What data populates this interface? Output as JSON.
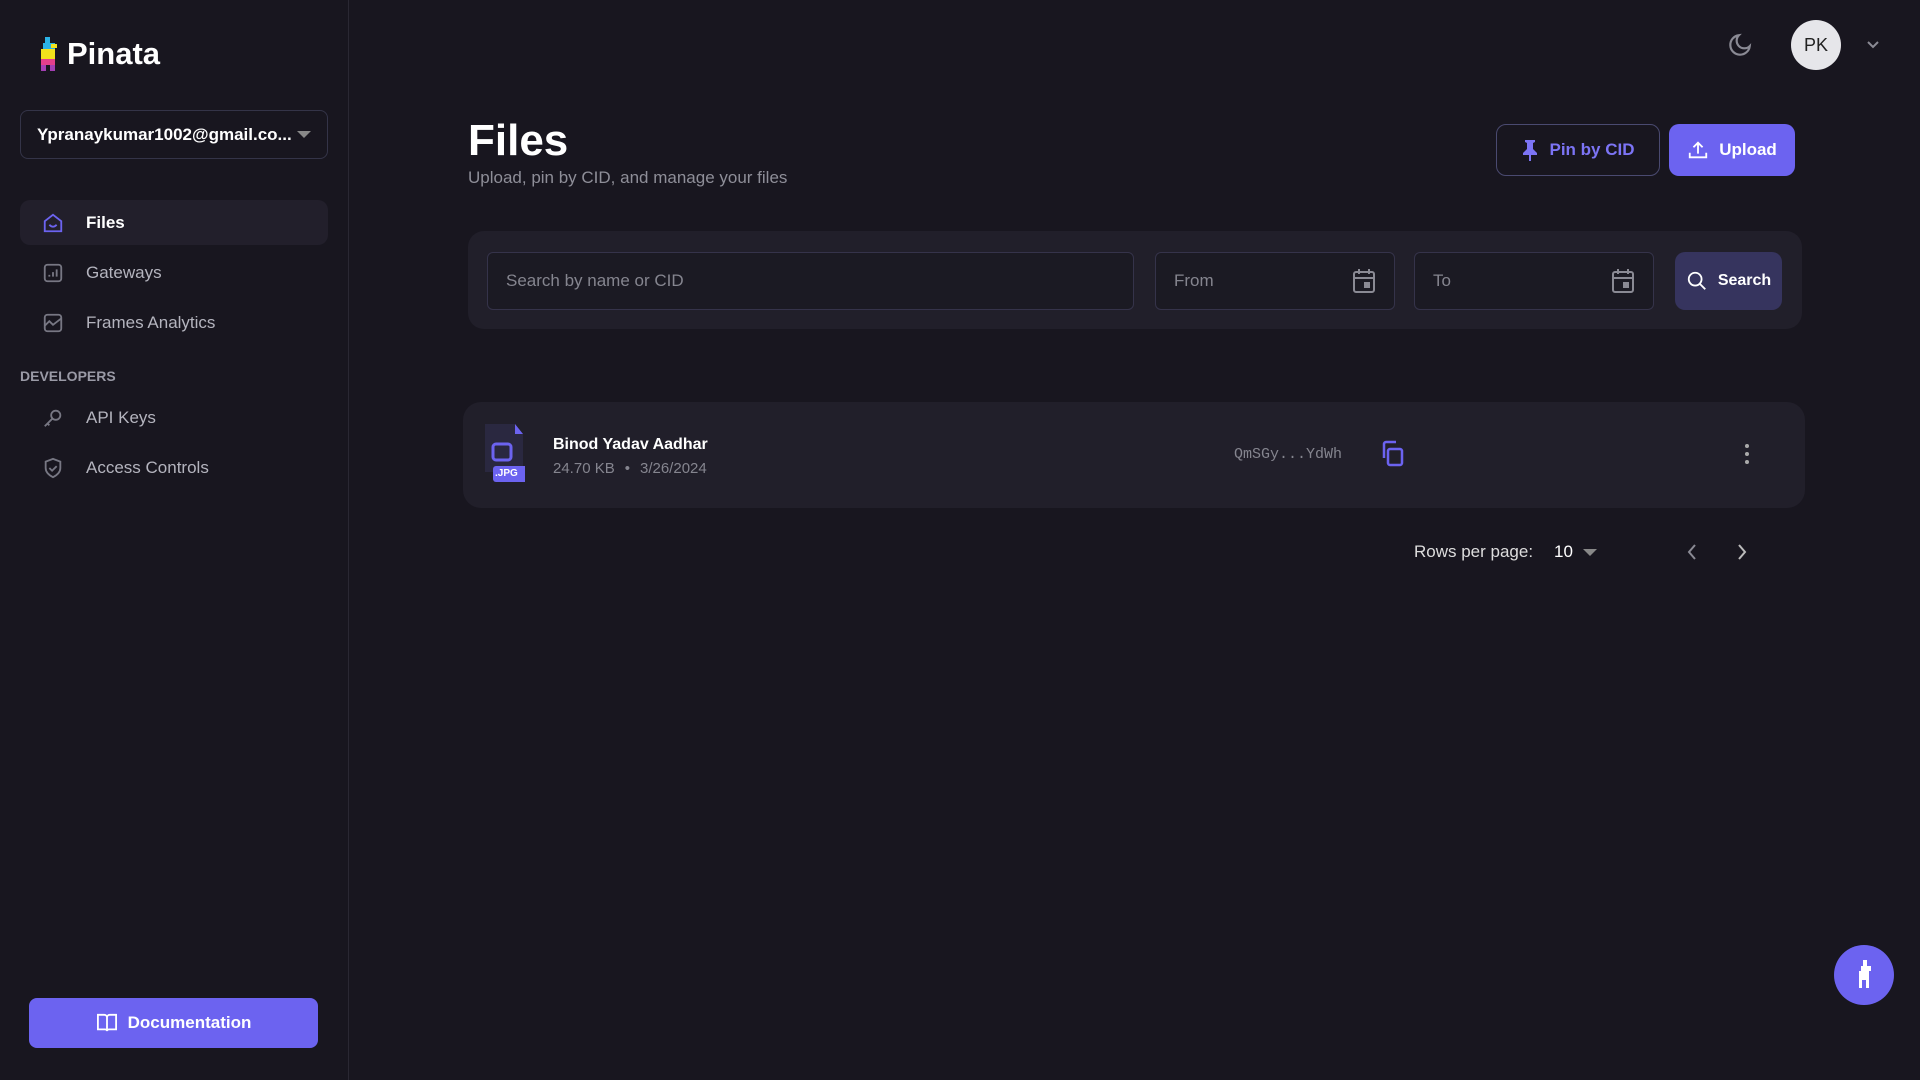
{
  "brand": {
    "name": "Pinata"
  },
  "sidebar": {
    "account": "Ypranaykumar1002@gmail.co...",
    "items": [
      {
        "label": "Files",
        "icon": "home-icon"
      },
      {
        "label": "Gateways",
        "icon": "chart-icon"
      },
      {
        "label": "Frames Analytics",
        "icon": "analytics-icon"
      }
    ],
    "section": "DEVELOPERS",
    "dev_items": [
      {
        "label": "API Keys",
        "icon": "key-icon"
      },
      {
        "label": "Access Controls",
        "icon": "shield-icon"
      }
    ],
    "documentation": "Documentation"
  },
  "header": {
    "avatar": "PK"
  },
  "main": {
    "title": "Files",
    "subtitle": "Upload, pin by CID, and manage your files",
    "pin_label": "Pin by CID",
    "upload_label": "Upload",
    "search": {
      "placeholder": "Search by name or CID",
      "from": "From",
      "to": "To",
      "button": "Search"
    },
    "files": [
      {
        "name": "Binod Yadav Aadhar",
        "size": "24.70 KB",
        "date": "3/26/2024",
        "cid": "QmSGy...YdWh",
        "ext": ".JPG"
      }
    ],
    "pagination": {
      "rows_label": "Rows per page:",
      "rows_value": "10"
    }
  },
  "colors": {
    "accent": "#6c63f0",
    "background": "#18161f"
  }
}
